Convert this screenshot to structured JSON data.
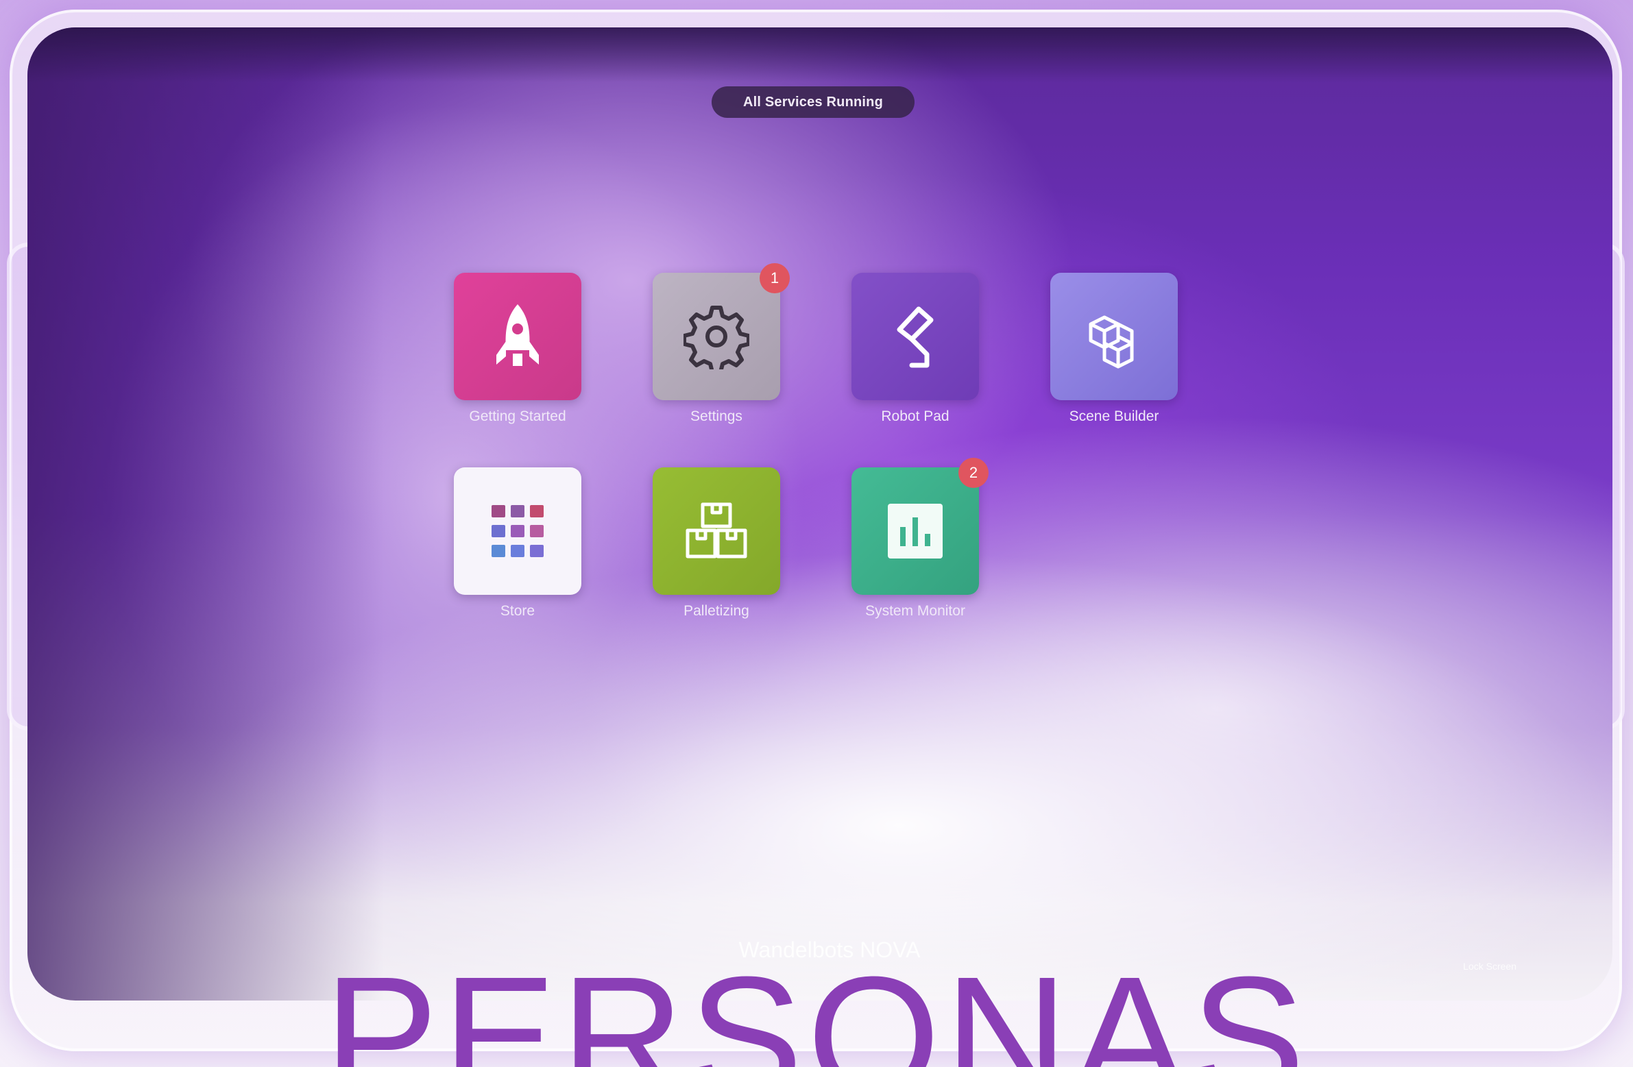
{
  "status": {
    "label": "All Services Running"
  },
  "apps": [
    {
      "label": "Getting Started",
      "icon": "rocket-icon",
      "color": "#d43c8e",
      "badge": ""
    },
    {
      "label": "Settings",
      "icon": "gear-icon",
      "color": "#b3aab8",
      "badge": "1"
    },
    {
      "label": "Robot Pad",
      "icon": "robot-arm-icon",
      "color": "#7a44c2",
      "badge": ""
    },
    {
      "label": "Scene Builder",
      "icon": "cubes-icon",
      "color": "#8b7ee0",
      "badge": ""
    },
    {
      "label": "Store",
      "icon": "grid-icon",
      "color": "#f7f4fb",
      "badge": ""
    },
    {
      "label": "Palletizing",
      "icon": "boxes-icon",
      "color": "#8fb52f",
      "badge": ""
    },
    {
      "label": "System Monitor",
      "icon": "chart-icon",
      "color": "#3fb38f",
      "badge": "2"
    }
  ],
  "footer": {
    "brand": "Wandelbots NOVA",
    "right": "Lock Screen"
  },
  "headline": "PERSONAS"
}
